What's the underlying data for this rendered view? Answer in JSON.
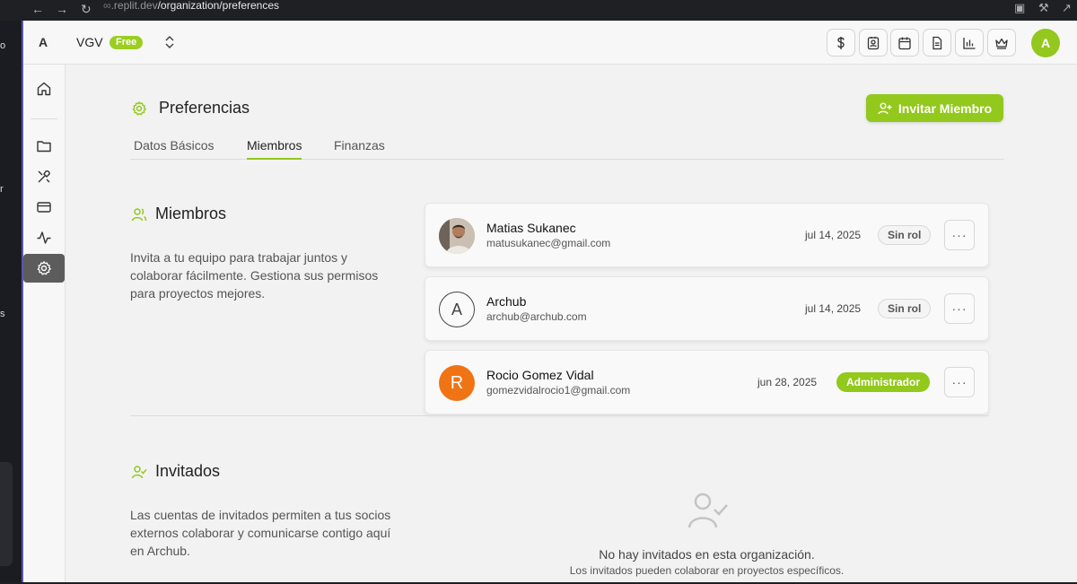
{
  "browser": {
    "url_host": ".replit.dev",
    "url_path": "/organization/preferences"
  },
  "left_strip_chars": [
    "o",
    "r",
    "s"
  ],
  "topbar": {
    "logo_letter": "A",
    "org_name": "VGV",
    "plan_badge": "Free",
    "user_initial": "A",
    "tool_icons": [
      "dollar-icon",
      "contact-card-icon",
      "calendar-icon",
      "document-icon",
      "bar-chart-icon",
      "crown-icon"
    ]
  },
  "sidebar": {
    "items": [
      "home-icon",
      "folder-icon",
      "tools-icon",
      "credit-card-icon",
      "activity-icon",
      "gear-icon"
    ],
    "active": "gear-icon"
  },
  "page": {
    "title": "Preferencias",
    "invite_button": "Invitar Miembro",
    "tabs": [
      {
        "label": "Datos Básicos",
        "active": false
      },
      {
        "label": "Miembros",
        "active": true
      },
      {
        "label": "Finanzas",
        "active": false
      }
    ]
  },
  "members_section": {
    "title": "Miembros",
    "description": "Invita a tu equipo para trabajar juntos y colaborar fácilmente. Gestiona sus permisos para proyectos mejores.",
    "members": [
      {
        "name": "Matias Sukanec",
        "email": "matusukanec@gmail.com",
        "date": "jul 14, 2025",
        "role": "Sin rol",
        "avatar": "photo",
        "more": "···"
      },
      {
        "name": "Archub",
        "email": "archub@archub.com",
        "date": "jul 14, 2025",
        "role": "Sin rol",
        "avatar": "A",
        "more": "···"
      },
      {
        "name": "Rocio Gomez Vidal",
        "email": "gomezvidalrocio1@gmail.com",
        "date": "jun 28, 2025",
        "role": "Administrador",
        "avatar": "R",
        "more": "···"
      }
    ]
  },
  "guests_section": {
    "title": "Invitados",
    "description": "Las cuentas de invitados permiten a tus socios externos colaborar y comunicarse contigo aquí en Archub.",
    "empty_title": "No hay invitados en esta organización.",
    "empty_subtitle": "Los invitados pueden colaborar en proyectos específicos."
  },
  "colors": {
    "accent": "#93c81d",
    "admin_badge": "#93c81d",
    "avatar_r": "#f07314"
  }
}
